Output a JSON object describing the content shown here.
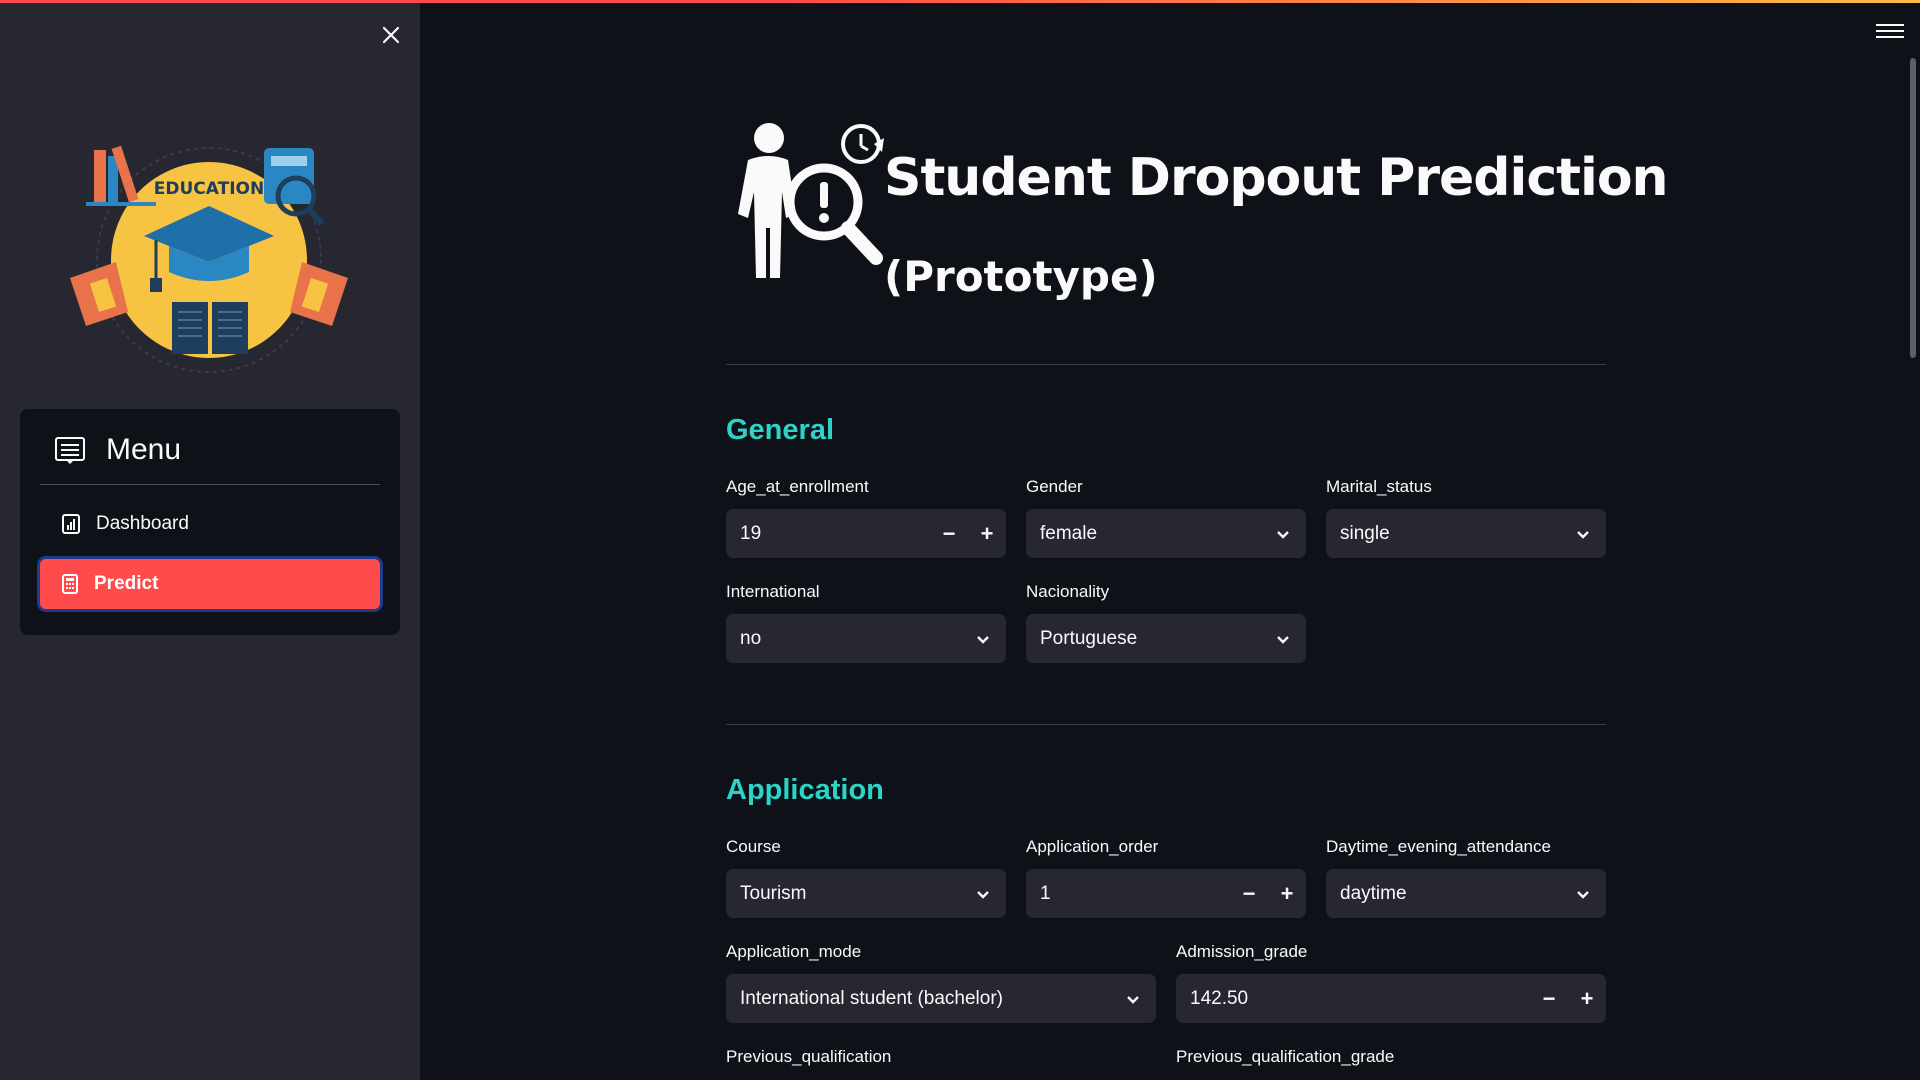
{
  "sidebar": {
    "logo_text": "EDUCATION",
    "menu": {
      "title": "Menu",
      "items": [
        {
          "label": "Dashboard",
          "active": false
        },
        {
          "label": "Predict",
          "active": true
        }
      ]
    }
  },
  "header": {
    "title": "Student Dropout Prediction",
    "subtitle": "(Prototype)"
  },
  "sections": {
    "general": {
      "title": "General",
      "fields": {
        "age": {
          "label": "Age_at_enrollment",
          "value": "19"
        },
        "gender": {
          "label": "Gender",
          "value": "female"
        },
        "marital": {
          "label": "Marital_status",
          "value": "single"
        },
        "international": {
          "label": "International",
          "value": "no"
        },
        "nationality": {
          "label": "Nacionality",
          "value": "Portuguese"
        }
      }
    },
    "application": {
      "title": "Application",
      "fields": {
        "course": {
          "label": "Course",
          "value": "Tourism"
        },
        "order": {
          "label": "Application_order",
          "value": "1"
        },
        "attendance": {
          "label": "Daytime_evening_attendance",
          "value": "daytime"
        },
        "mode": {
          "label": "Application_mode",
          "value": "International student (bachelor)"
        },
        "admission": {
          "label": "Admission_grade",
          "value": "142.50"
        },
        "prev_qual": {
          "label": "Previous_qualification"
        },
        "prev_grade": {
          "label": "Previous_qualification_grade"
        }
      }
    }
  },
  "colors": {
    "accent": "#ff4b4b",
    "section_title": "#2ed3c7",
    "background": "#0e1117",
    "sidebar": "#262730"
  },
  "icons": [
    "close-icon",
    "menu-list-icon",
    "dashboard-icon",
    "calculator-icon",
    "hamburger-icon",
    "chevron-down-icon",
    "minus-icon",
    "plus-icon",
    "dropout-search-icon",
    "education-logo"
  ]
}
